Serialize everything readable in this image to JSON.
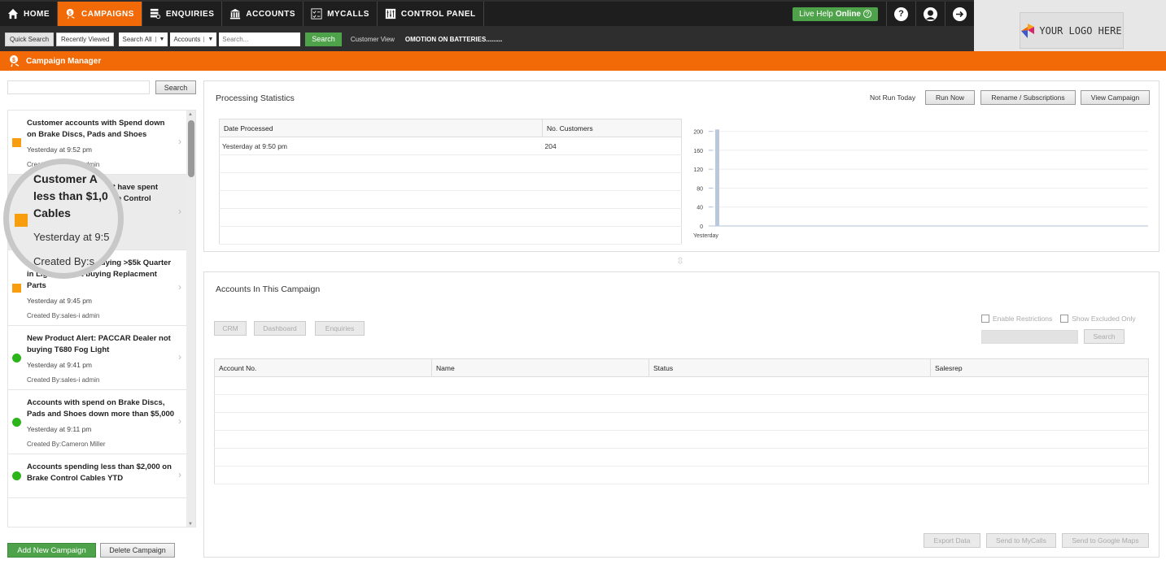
{
  "nav": {
    "items": [
      {
        "label": "HOME",
        "icon": "home-icon",
        "active": false
      },
      {
        "label": "CAMPAIGNS",
        "icon": "campaign-icon",
        "active": true
      },
      {
        "label": "ENQUIRIES",
        "icon": "enquiries-icon",
        "active": false
      },
      {
        "label": "ACCOUNTS",
        "icon": "bank-icon",
        "active": false
      },
      {
        "label": "MYCALLS",
        "icon": "checklist-icon",
        "active": false
      },
      {
        "label": "CONTROL PANEL",
        "icon": "control-panel-icon",
        "active": false
      }
    ],
    "live_help_prefix": "Live Help",
    "live_help_status": "Online",
    "help_icon": "?",
    "user_icon": "user-icon",
    "logout_icon": "logout-icon"
  },
  "search_bar": {
    "quick_search": "Quick Search",
    "recently_viewed": "Recently Viewed",
    "scope_select": "Search All",
    "type_select": "Accounts",
    "placeholder": "Search...",
    "search_button": "Search",
    "customer_view": "Customer View",
    "promo_text": "OMOTION ON BATTERIES........."
  },
  "logo": {
    "text": "YOUR LOGO HERE"
  },
  "page_header": {
    "title": "Campaign Manager"
  },
  "sidebar": {
    "search_value": "",
    "search_button": "Search",
    "campaigns": [
      {
        "title": "Customer accounts with Spend down on Brake Discs, Pads and Shoes",
        "date": "Yesterday at 9:52 pm",
        "created_by": "Created By:sales-i admin",
        "status": "orange",
        "selected": false
      },
      {
        "title": "Customer accounts that have spent less than $1,000 on Brake Control Cables",
        "date": "Yesterday at 9:50 pm",
        "created_by": "Created By:sales-i admin",
        "status": "orange",
        "selected": true
      },
      {
        "title": "Mid-sized account buying >$5k Quarter in Lighting, Not buying Replacment Parts",
        "date": "Yesterday at 9:45 pm",
        "created_by": "Created By:sales-i admin",
        "status": "orange",
        "selected": false
      },
      {
        "title": "New Product Alert: PACCAR Dealer not buying T680 Fog Light",
        "date": "Yesterday at 9:41 pm",
        "created_by": "Created By:sales-i admin",
        "status": "green",
        "selected": false
      },
      {
        "title": "Accounts with spend on Brake Discs, Pads and Shoes down more than $5,000",
        "date": "Yesterday at 9:11 pm",
        "created_by": "Created By:Cameron Miller",
        "status": "green",
        "selected": false
      },
      {
        "title": "Accounts spending less than $2,000 on Brake Control Cables YTD",
        "date": "",
        "created_by": "",
        "status": "green",
        "selected": false
      }
    ],
    "magnifier": {
      "line1": "Customer A",
      "line2": "less than $1,0",
      "line3": "Cables",
      "line4": "Yesterday at 9:5",
      "line5": "Created By:s"
    },
    "add_button": "Add New Campaign",
    "delete_button": "Delete Campaign"
  },
  "processing": {
    "title": "Processing Statistics",
    "run_status": "Not Run Today",
    "run_now": "Run Now",
    "rename": "Rename / Subscriptions",
    "view": "View Campaign",
    "columns": [
      "Date Processed",
      "No. Customers"
    ],
    "rows": [
      [
        "Yesterday at 9:50 pm",
        "204"
      ],
      [
        "",
        ""
      ],
      [
        "",
        ""
      ],
      [
        "",
        ""
      ],
      [
        "",
        ""
      ],
      [
        "",
        ""
      ]
    ]
  },
  "chart_data": {
    "type": "bar",
    "categories": [
      "Yesterday"
    ],
    "values": [
      204
    ],
    "title": "",
    "xlabel": "",
    "ylabel": "",
    "ylim": [
      0,
      220
    ],
    "yticks": [
      0,
      40,
      80,
      120,
      160,
      200
    ],
    "grid": true,
    "bar_color": "#b9c9dc"
  },
  "accounts": {
    "title": "Accounts In This Campaign",
    "buttons": [
      "CRM",
      "Dashboard",
      "Enquiries"
    ],
    "enable_restrictions": "Enable Restrictions",
    "show_excluded": "Show Excluded Only",
    "search_button": "Search",
    "columns": [
      "Account No.",
      "Name",
      "Status",
      "Salesrep"
    ],
    "empty_rows": 6,
    "export": "Export Data",
    "send_mycalls": "Send to MyCalls",
    "send_maps": "Send to Google Maps"
  },
  "colors": {
    "brand_orange": "#f26a07",
    "green": "#4ea24a",
    "status_orange": "#f89d0e",
    "status_green": "#2bb51a"
  }
}
